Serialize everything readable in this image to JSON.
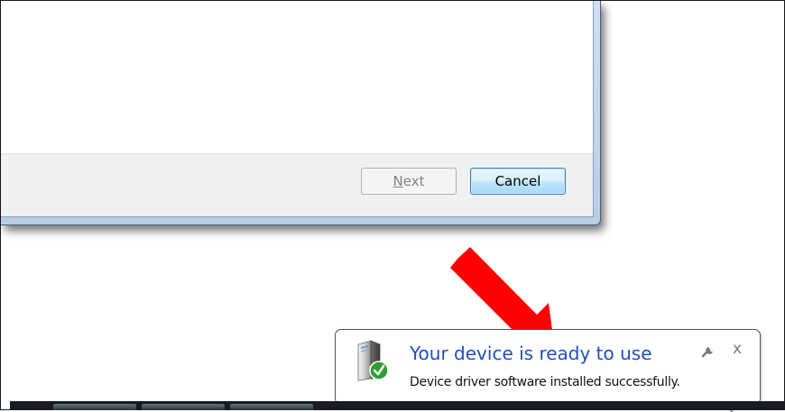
{
  "wizard": {
    "next_label_underlined": "N",
    "next_label_rest": "ext",
    "cancel_label": "Cancel"
  },
  "notification": {
    "title": "Your device is ready to use",
    "message": "Device driver software installed successfully.",
    "close_glyph": "x",
    "icon": "device-driver-icon",
    "options_icon": "wrench-icon"
  },
  "colors": {
    "title_blue": "#1f4fbf",
    "arrow_red": "#ff0000",
    "check_green": "#2e9e2e"
  }
}
